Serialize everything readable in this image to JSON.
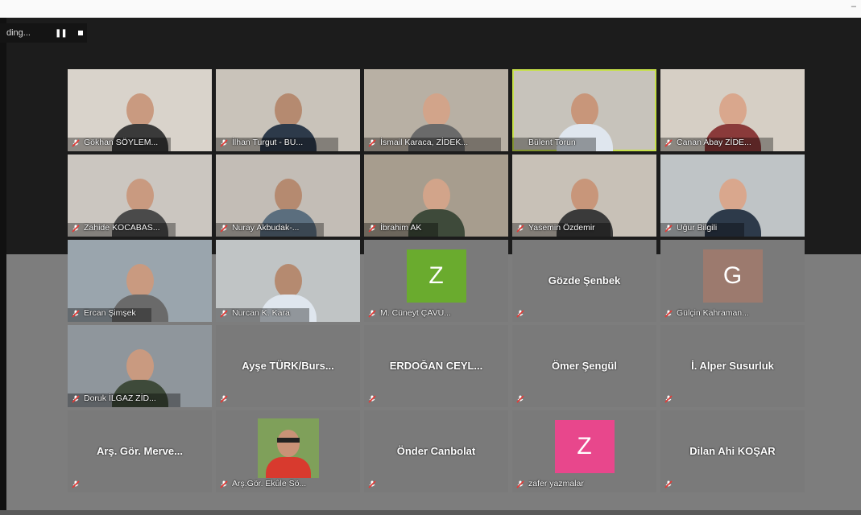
{
  "window": {
    "controls": "–"
  },
  "recording": {
    "status": "ding...",
    "pause_icon": "pause-icon",
    "stop_icon": "stop-icon"
  },
  "colors": {
    "active_speaker": "#c6e04a",
    "mute_icon": "#e53935",
    "avatar_z_green": "#6aab2e",
    "avatar_g_tan": "#9c7a6e",
    "avatar_z_pink": "#e8478c"
  },
  "participants": [
    {
      "name": "Gökhan SÖYLEM...",
      "kind": "video",
      "muted": true
    },
    {
      "name": "İlhan Turgut - BU...",
      "kind": "video",
      "muted": true
    },
    {
      "name": "İsmail Karaca, ZİDEK...",
      "kind": "video",
      "muted": true
    },
    {
      "name": "Bülent Torun",
      "kind": "video",
      "muted": false,
      "active": true
    },
    {
      "name": "Canan Abay ZİDE...",
      "kind": "video",
      "muted": true
    },
    {
      "name": "Zahide KOCABAS...",
      "kind": "video",
      "muted": true
    },
    {
      "name": "Nuray Akbudak-...",
      "kind": "video",
      "muted": true
    },
    {
      "name": "İbrahim AK",
      "kind": "video",
      "muted": true
    },
    {
      "name": "Yasemin Özdemir",
      "kind": "video",
      "muted": true
    },
    {
      "name": "Uğur Bilgili",
      "kind": "video",
      "muted": true
    },
    {
      "name": "Ercan Şimşek",
      "kind": "video",
      "muted": true
    },
    {
      "name": "Nurcan K. Kara",
      "kind": "video",
      "muted": true
    },
    {
      "name": "M. Cüneyt ÇAVU...",
      "kind": "avatar",
      "initial": "Z",
      "muted": true
    },
    {
      "name": "Gözde Şenbek",
      "kind": "center",
      "muted": true
    },
    {
      "name": "Gülçin Kahraman...",
      "kind": "avatar",
      "initial": "G",
      "muted": true
    },
    {
      "name": "Doruk İLGAZ ZİD...",
      "kind": "video",
      "muted": true
    },
    {
      "name": "Ayşe TÜRK/Burs...",
      "kind": "center",
      "muted": true
    },
    {
      "name": "ERDOĞAN  CEYL...",
      "kind": "center",
      "muted": true
    },
    {
      "name": "Ömer Şengül",
      "kind": "center",
      "muted": true
    },
    {
      "name": "İ. Alper Susurluk",
      "kind": "center",
      "muted": true
    },
    {
      "name": "Arş. Gör. Merve...",
      "kind": "center",
      "muted": true
    },
    {
      "name": "Arş.Gör. Ekûle Sö...",
      "kind": "photo",
      "muted": true
    },
    {
      "name": "Önder Canbolat",
      "kind": "center",
      "muted": true
    },
    {
      "name": "zafer yazmalar",
      "kind": "avatar",
      "initial": "Z",
      "muted": true
    },
    {
      "name": "Dilan Ahi KOŞAR",
      "kind": "center",
      "muted": true
    }
  ]
}
